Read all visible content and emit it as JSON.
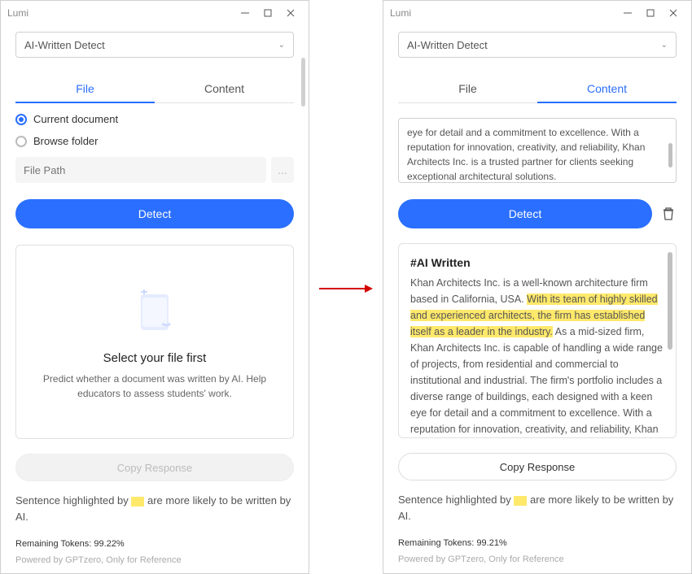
{
  "app_title": "Lumi",
  "dropdown": {
    "label": "AI-Written Detect"
  },
  "tabs": {
    "file": "File",
    "content": "Content"
  },
  "radios": {
    "current": "Current document",
    "browse": "Browse folder"
  },
  "filepath": {
    "placeholder": "File Path",
    "browse_btn": "..."
  },
  "detect_label": "Detect",
  "empty": {
    "title": "Select your file first",
    "desc": "Predict whether a document was written by AI. Help educators to assess students' work."
  },
  "copy_label": "Copy Response",
  "hint_pre": "Sentence highlighted by ",
  "hint_post": " are more likely to be written by AI.",
  "tokens_left": "Remaining Tokens: 99.22%",
  "tokens_right": "Remaining Tokens: 99.21%",
  "powered": "Powered by GPTzero, Only for Reference",
  "textarea_text": "eye for detail and a commitment to excellence. With a reputation for innovation, creativity, and reliability, Khan Architects Inc. is a trusted partner for clients seeking exceptional architectural solutions.",
  "result": {
    "heading": "#AI Written",
    "p1": "Khan Architects Inc. is a well-known architecture firm based in California, USA. ",
    "hl": "With its team of highly skilled and experienced architects, the firm has established itself as a leader in the industry.",
    "p2": " As a mid-sized firm, Khan Architects Inc. is capable of handling a wide range of projects, from residential and commercial to institutional and industrial. The firm's portfolio includes a diverse range of buildings, each designed with a keen eye for detail and a commitment to excellence. With a reputation for innovation, creativity, and reliability, Khan Architects"
  }
}
